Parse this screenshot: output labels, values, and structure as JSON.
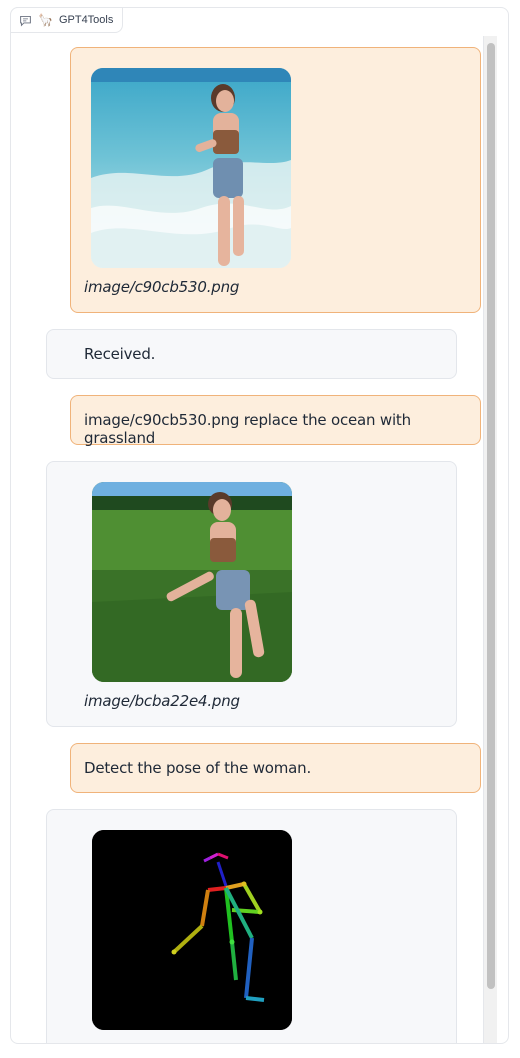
{
  "app": {
    "title": "GPT4Tools",
    "title_icon": "llama-icon"
  },
  "messages": [
    {
      "role": "user",
      "type": "image",
      "caption": "image/c90cb530.png",
      "image": "woman at beach in waves"
    },
    {
      "role": "bot",
      "type": "text",
      "text": "Received."
    },
    {
      "role": "user",
      "type": "text",
      "text": "image/c90cb530.png replace the ocean with grassland"
    },
    {
      "role": "bot",
      "type": "image",
      "caption": "image/bcba22e4.png",
      "image": "woman on grassland"
    },
    {
      "role": "user",
      "type": "text",
      "text": "Detect the pose of the woman."
    },
    {
      "role": "bot",
      "type": "image",
      "caption": "",
      "image": "pose skeleton on black background"
    }
  ],
  "colors": {
    "user_bg": "#fdeedd",
    "user_border": "#f0b37a",
    "bot_bg": "#f7f8fa",
    "bot_border": "#e3e6eb"
  }
}
